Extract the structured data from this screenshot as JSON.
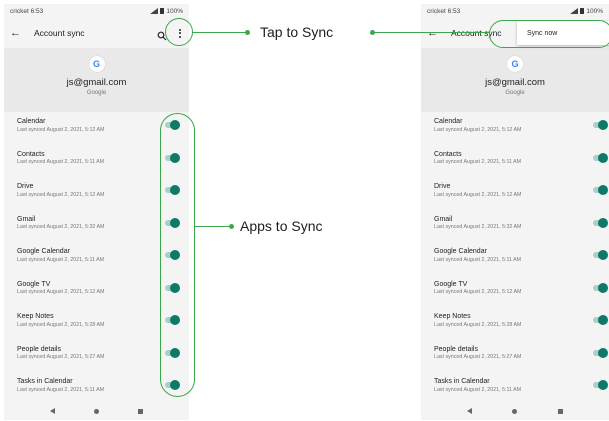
{
  "left_phone": {
    "status": {
      "carrier_time": "cricket 6:53",
      "battery": "100%"
    },
    "app_bar": {
      "title": "Account sync",
      "back_icon": "back-arrow-icon",
      "search_icon": "search-icon",
      "more_icon": "more-vert-icon"
    },
    "account": {
      "email": "js@gmail.com",
      "provider": "Google",
      "logo_letter": "G"
    },
    "items": [
      {
        "name": "Calendar",
        "status": "Last synced August 2, 2021, 5:12 AM",
        "enabled": true
      },
      {
        "name": "Contacts",
        "status": "Last synced August 2, 2021, 5:11 AM",
        "enabled": true
      },
      {
        "name": "Drive",
        "status": "Last synced August 2, 2021, 5:12 AM",
        "enabled": true
      },
      {
        "name": "Gmail",
        "status": "Last synced August 2, 2021, 5:32 AM",
        "enabled": true
      },
      {
        "name": "Google Calendar",
        "status": "Last synced August 2, 2021, 5:11 AM",
        "enabled": true
      },
      {
        "name": "Google TV",
        "status": "Last synced August 2, 2021, 5:12 AM",
        "enabled": true
      },
      {
        "name": "Keep Notes",
        "status": "Last synced August 2, 2021, 5:28 AM",
        "enabled": true
      },
      {
        "name": "People details",
        "status": "Last synced August 2, 2021, 5:27 AM",
        "enabled": true
      },
      {
        "name": "Tasks in Calendar",
        "status": "Last synced August 2, 2021, 5:11 AM",
        "enabled": true
      }
    ]
  },
  "right_phone": {
    "status": {
      "carrier_time": "cricket 6:53",
      "battery": "100%"
    },
    "app_bar": {
      "title": "Account sync"
    },
    "menu": {
      "sync_now": "Sync now"
    },
    "account": {
      "email": "js@gmail.com",
      "provider": "Google",
      "logo_letter": "G"
    },
    "items": [
      {
        "name": "Calendar",
        "status": "Last synced August 2, 2021, 5:12 AM",
        "enabled": true
      },
      {
        "name": "Contacts",
        "status": "Last synced August 2, 2021, 5:11 AM",
        "enabled": true
      },
      {
        "name": "Drive",
        "status": "Last synced August 2, 2021, 5:12 AM",
        "enabled": true
      },
      {
        "name": "Gmail",
        "status": "Last synced August 2, 2021, 5:32 AM",
        "enabled": true
      },
      {
        "name": "Google Calendar",
        "status": "Last synced August 2, 2021, 5:11 AM",
        "enabled": true
      },
      {
        "name": "Google TV",
        "status": "Last synced August 2, 2021, 5:12 AM",
        "enabled": true
      },
      {
        "name": "Keep Notes",
        "status": "Last synced August 2, 2021, 5:28 AM",
        "enabled": true
      },
      {
        "name": "People details",
        "status": "Last synced August 2, 2021, 5:27 AM",
        "enabled": true
      },
      {
        "name": "Tasks in Calendar",
        "status": "Last synced August 2, 2021, 5:11 AM",
        "enabled": true
      }
    ]
  },
  "annotations": {
    "tap_to_sync": "Tap to Sync",
    "apps_to_sync": "Apps to Sync",
    "highlight_color": "#3aa84a",
    "toggle_color": "#0c7a66"
  }
}
